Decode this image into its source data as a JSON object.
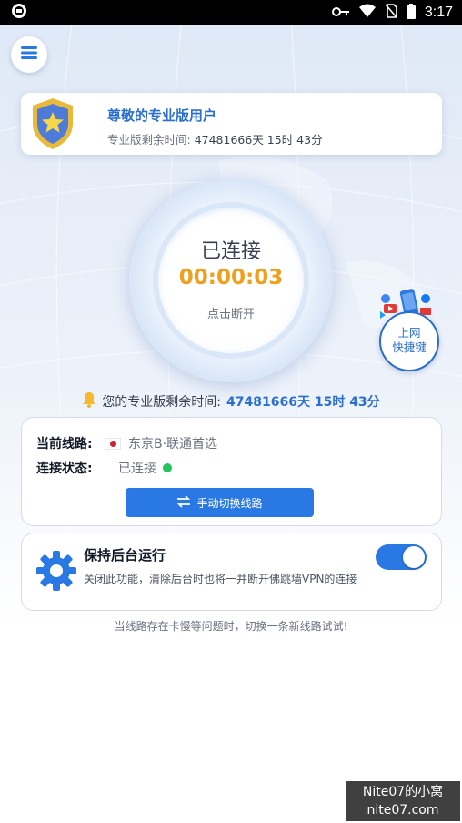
{
  "status_bar": {
    "time": "3:17",
    "icons": [
      "notification-icon",
      "key-icon",
      "wifi-icon",
      "no-sim-icon",
      "battery-icon"
    ]
  },
  "header": {
    "menu_icon": "hamburger-icon"
  },
  "pro_card": {
    "title": "尊敬的专业版用户",
    "remaining_label": "专业版剩余时间:",
    "remaining_value": "47481666天 15时 43分",
    "badge_icon": "star-shield-icon"
  },
  "connection": {
    "status": "已连接",
    "timer": "00:00:03",
    "action": "点击断开"
  },
  "shortcut": {
    "line1": "上网",
    "line2": "快捷键"
  },
  "remain_line": {
    "label": "您的专业版剩余时间:",
    "value": "47481666天 15时 43分"
  },
  "line_card": {
    "route_label": "当前线路:",
    "route_value": "东京B·联通首选",
    "state_label": "连接状态:",
    "state_value": "已连接",
    "switch_button": "手动切换线路"
  },
  "background_card": {
    "title": "保持后台运行",
    "description": "关闭此功能，清除后台时也将一并断开佛跳墙VPN的连接",
    "toggle_on": true
  },
  "tip": "当线路存在卡慢等问题时，切换一条新线路试试!",
  "watermark": {
    "line1": "Nite07的小窝",
    "line2": "nite07.com"
  },
  "colors": {
    "accent": "#2a78e4",
    "timer": "#f0a01e",
    "connected_dot": "#22c55e"
  }
}
